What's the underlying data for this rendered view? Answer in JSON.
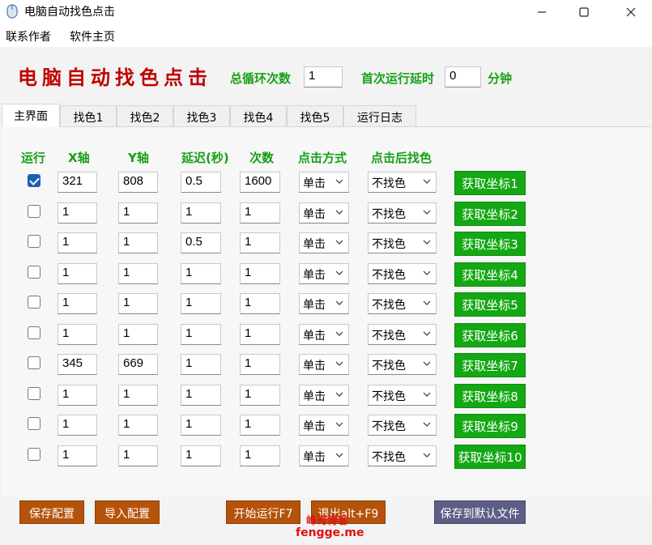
{
  "window": {
    "title": "电脑自动找色点击",
    "icon": "mouse-icon"
  },
  "menu": [
    "联系作者",
    "软件主页"
  ],
  "header": {
    "heading": "电脑自动找色点击",
    "loop_label": "总循环次数",
    "loop_value": "1",
    "delay_label": "首次运行延时",
    "delay_value": "0",
    "delay_unit": "分钟"
  },
  "tabs": [
    "主界面",
    "找色1",
    "找色2",
    "找色3",
    "找色4",
    "找色5",
    "运行日志"
  ],
  "active_tab": 0,
  "columns": [
    "运行",
    "X轴",
    "Y轴",
    "延迟(秒)",
    "次数",
    "点击方式",
    "点击后找色"
  ],
  "rows": [
    {
      "checked": true,
      "x": "321",
      "y": "808",
      "delay": "0.5",
      "count": "1600",
      "click": "单击",
      "after": "不找色",
      "button": "获取坐标1"
    },
    {
      "checked": false,
      "x": "1",
      "y": "1",
      "delay": "1",
      "count": "1",
      "click": "单击",
      "after": "不找色",
      "button": "获取坐标2"
    },
    {
      "checked": false,
      "x": "1",
      "y": "1",
      "delay": "0.5",
      "count": "1",
      "click": "单击",
      "after": "不找色",
      "button": "获取坐标3"
    },
    {
      "checked": false,
      "x": "1",
      "y": "1",
      "delay": "1",
      "count": "1",
      "click": "单击",
      "after": "不找色",
      "button": "获取坐标4"
    },
    {
      "checked": false,
      "x": "1",
      "y": "1",
      "delay": "1",
      "count": "1",
      "click": "单击",
      "after": "不找色",
      "button": "获取坐标5"
    },
    {
      "checked": false,
      "x": "1",
      "y": "1",
      "delay": "1",
      "count": "1",
      "click": "单击",
      "after": "不找色",
      "button": "获取坐标6"
    },
    {
      "checked": false,
      "x": "345",
      "y": "669",
      "delay": "1",
      "count": "1",
      "click": "单击",
      "after": "不找色",
      "button": "获取坐标7"
    },
    {
      "checked": false,
      "x": "1",
      "y": "1",
      "delay": "1",
      "count": "1",
      "click": "单击",
      "after": "不找色",
      "button": "获取坐标8"
    },
    {
      "checked": false,
      "x": "1",
      "y": "1",
      "delay": "1",
      "count": "1",
      "click": "单击",
      "after": "不找色",
      "button": "获取坐标9"
    },
    {
      "checked": false,
      "x": "1",
      "y": "1",
      "delay": "1",
      "count": "1",
      "click": "单击",
      "after": "不找色",
      "button": "获取坐标10"
    }
  ],
  "footer": {
    "save": "保存配置",
    "import": "导入配置",
    "start": "开始运行F7",
    "exit": "退出alt+F9",
    "save_default": "保存到默认文件"
  },
  "watermark": {
    "line1": "峰哥博客",
    "line2": "fengge.me"
  },
  "colors": {
    "heading": "#c00000",
    "label_green": "#16a016",
    "button_green": "#14a814",
    "button_brown": "#b45309",
    "button_slate": "#5b5f86",
    "checkbox": "#1a5fb4"
  }
}
